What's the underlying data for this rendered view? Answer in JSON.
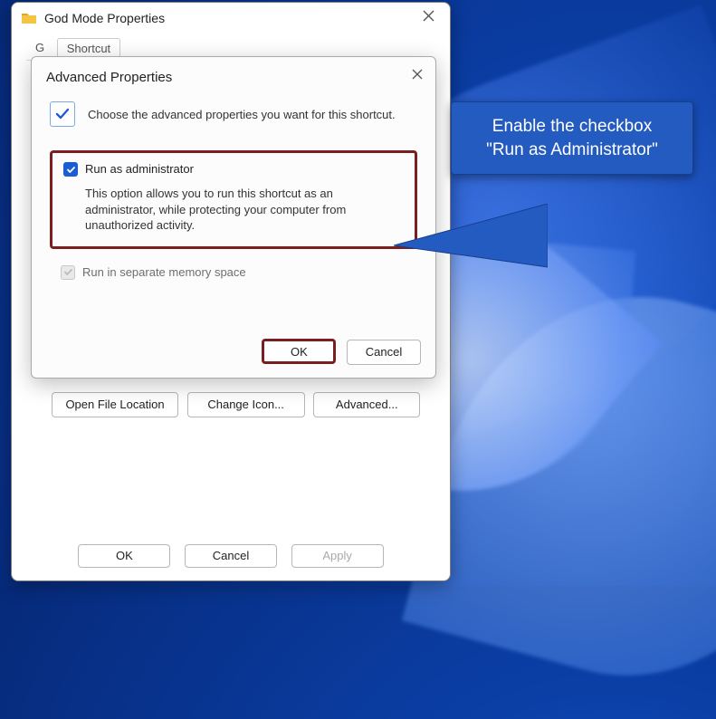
{
  "properties_window": {
    "title": "God Mode Properties",
    "tabs": {
      "general": "G",
      "shortcut": "Shortcut",
      "rest": "..."
    },
    "buttons": {
      "open_location": "Open File Location",
      "change_icon": "Change Icon...",
      "advanced": "Advanced..."
    },
    "dialog_buttons": {
      "ok": "OK",
      "cancel": "Cancel",
      "apply": "Apply"
    }
  },
  "advanced_dialog": {
    "title": "Advanced Properties",
    "header_text": "Choose the advanced properties you want for this shortcut.",
    "run_as_admin": {
      "label": "Run as administrator",
      "checked": true,
      "description": "This option allows you to run this shortcut as an administrator, while protecting your computer from unauthorized activity."
    },
    "separate_memory": {
      "label": "Run in separate memory space",
      "enabled": false
    },
    "buttons": {
      "ok": "OK",
      "cancel": "Cancel"
    }
  },
  "callout": {
    "line1": "Enable the checkbox",
    "line2": "\"Run as Administrator\""
  },
  "colors": {
    "accent": "#1a5cd6",
    "highlight_border": "#7a1f1f",
    "callout_bg": "#245bc1"
  }
}
